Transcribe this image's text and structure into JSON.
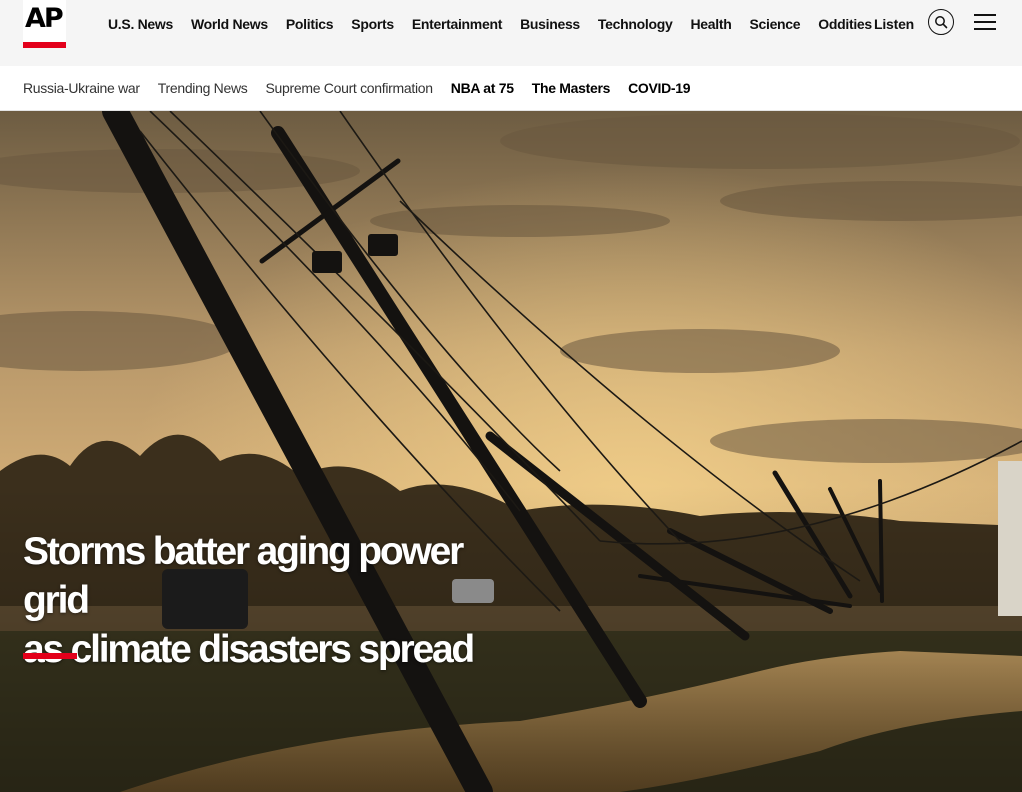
{
  "logo": {
    "text": "AP"
  },
  "main_nav": [
    {
      "label": "U.S. News"
    },
    {
      "label": "World News"
    },
    {
      "label": "Politics"
    },
    {
      "label": "Sports"
    },
    {
      "label": "Entertainment"
    },
    {
      "label": "Business"
    },
    {
      "label": "Technology"
    },
    {
      "label": "Health"
    },
    {
      "label": "Science"
    },
    {
      "label": "Oddities"
    }
  ],
  "header_actions": {
    "listen_label": "Listen",
    "search_icon": "search-icon",
    "menu_icon": "hamburger-menu-icon"
  },
  "trending": [
    {
      "label": "Russia-Ukraine war"
    },
    {
      "label": "Trending News"
    },
    {
      "label": "Supreme Court confirmation"
    },
    {
      "label": "NBA at 75"
    },
    {
      "label": "The Masters"
    },
    {
      "label": "COVID-19"
    }
  ],
  "hero": {
    "headline_line1": "Storms batter aging power grid",
    "headline_line2": "as climate disasters spread"
  },
  "colors": {
    "brand_red": "#e3001b",
    "header_bg": "#f5f5f5",
    "text": "#111111"
  }
}
